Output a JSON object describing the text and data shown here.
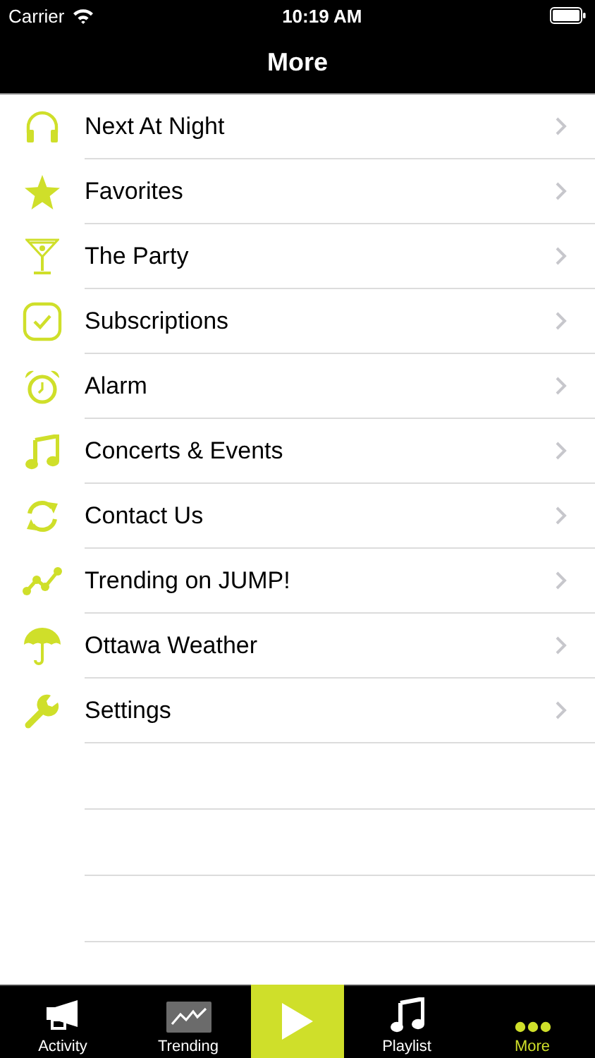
{
  "status_bar": {
    "carrier": "Carrier",
    "time": "10:19 AM"
  },
  "nav": {
    "title": "More"
  },
  "items": [
    {
      "label": "Next At Night"
    },
    {
      "label": "Favorites"
    },
    {
      "label": "The Party"
    },
    {
      "label": "Subscriptions"
    },
    {
      "label": "Alarm"
    },
    {
      "label": "Concerts & Events"
    },
    {
      "label": "Contact Us"
    },
    {
      "label": "Trending on JUMP!"
    },
    {
      "label": "Ottawa Weather"
    },
    {
      "label": "Settings"
    }
  ],
  "tab_bar": [
    {
      "kind": "tab",
      "label": "Activity",
      "selected": false
    },
    {
      "kind": "tab",
      "label": "Trending",
      "selected": false
    },
    {
      "kind": "play"
    },
    {
      "kind": "tab",
      "label": "Playlist",
      "selected": false
    },
    {
      "kind": "tab",
      "label": "More",
      "selected": true
    }
  ]
}
